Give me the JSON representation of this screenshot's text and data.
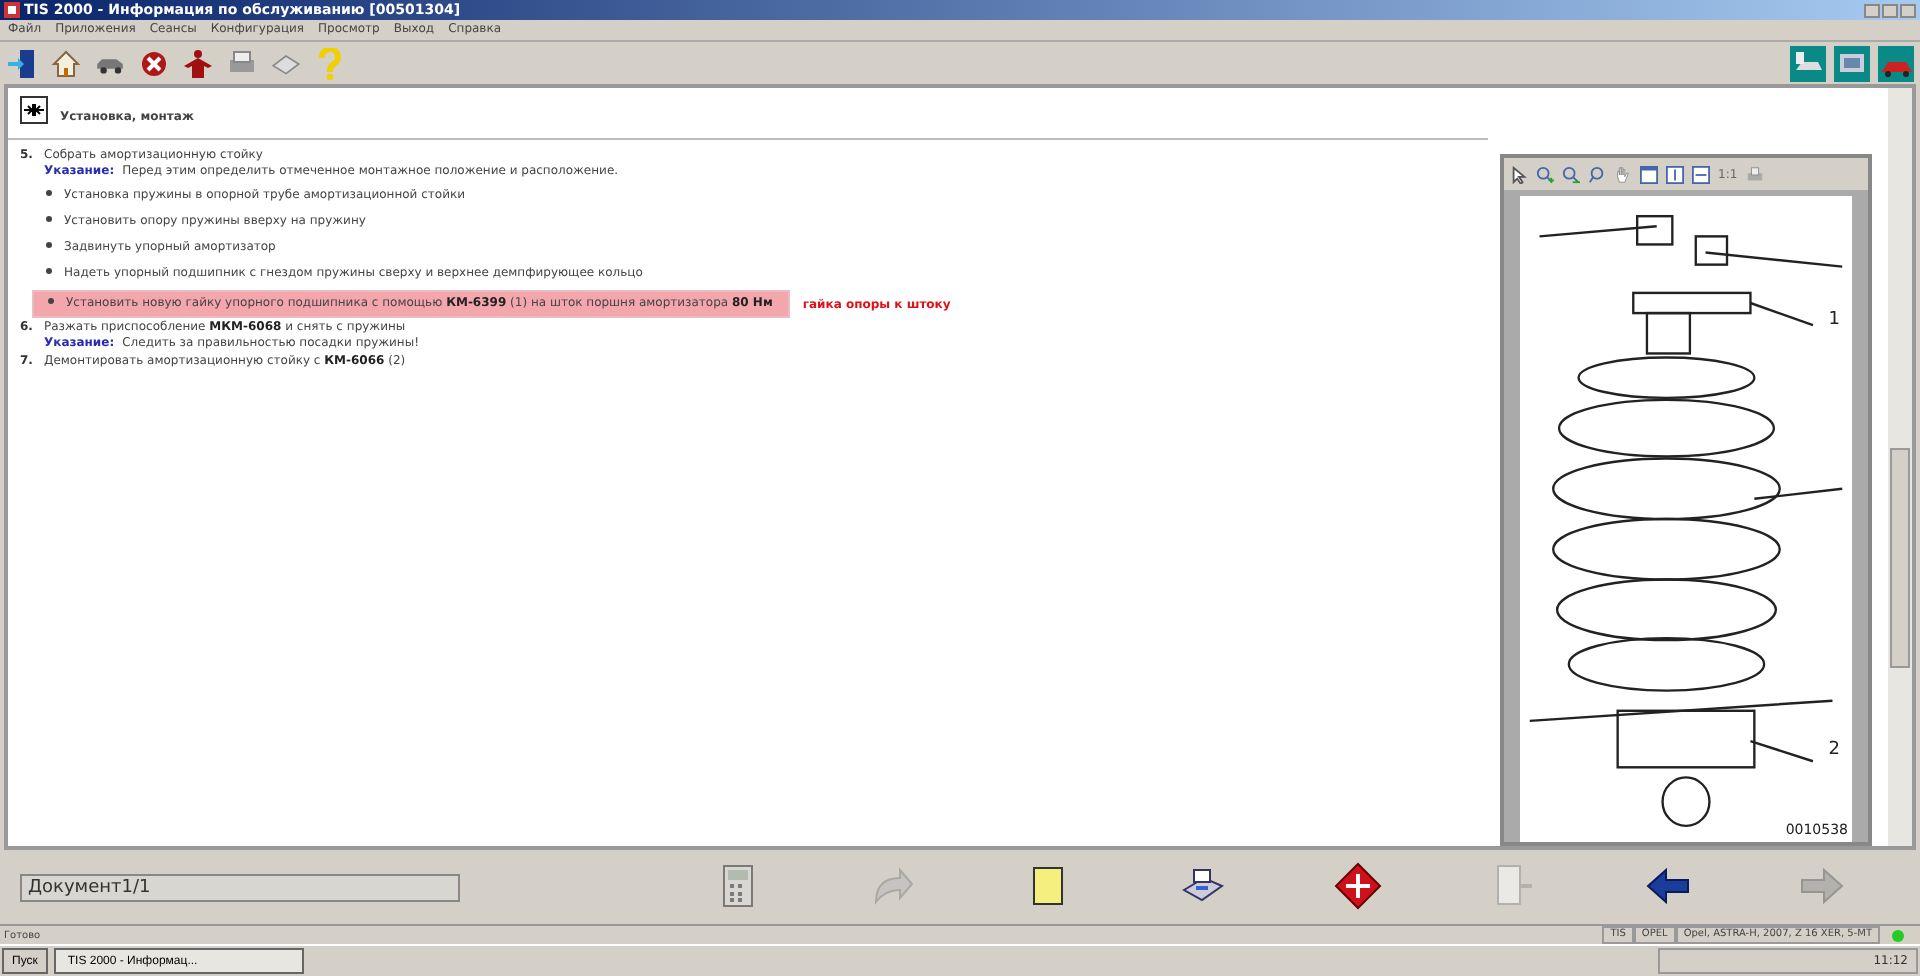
{
  "window": {
    "title": "TIS 2000 - Информация по обслуживанию [00501304]"
  },
  "menu": [
    "Файл",
    "Приложения",
    "Сеансы",
    "Конфигурация",
    "Просмотр",
    "Выход",
    "Справка"
  ],
  "section": {
    "title": "Установка, монтаж"
  },
  "steps": [
    {
      "number": "5.",
      "text": "Собрать амортизационную стойку",
      "note": {
        "label": "Указание:",
        "text": "Перед этим определить отмеченное монтажное положение и расположение."
      },
      "bullets": [
        {
          "text": "Установка пружины в опорной трубе амортизационной стойки",
          "highlighted": false
        },
        {
          "text": "Установить опору пружины вверху на пружину",
          "highlighted": false
        },
        {
          "text": "Задвинуть упорный амортизатор",
          "highlighted": false
        },
        {
          "text": "Надеть упорный подшипник с гнездом пружины сверху и верхнее демпфирующее кольцо",
          "highlighted": false
        },
        {
          "text": "Установить новую гайку упорного подшипника с помощью **КМ-6399** (1) на шток поршня амортизатора **80 Нм**",
          "highlighted": true,
          "annotation": "гайка опоры к штоку"
        }
      ]
    },
    {
      "number": "6.",
      "text": "Разжать приспособление **МКМ-6068** и снять с пружины",
      "note": {
        "label": "Указание:",
        "text": "Следить за правильностью посадки пружины!"
      }
    },
    {
      "number": "7.",
      "text": "Демонтировать амортизационную стойку с **КМ-6066** (2)"
    }
  ],
  "viewer": {
    "scale_label": "1:1",
    "callouts": [
      "1",
      "2"
    ],
    "figure_id": "0010538"
  },
  "document_field": {
    "value": "Документ1/1"
  },
  "nav_buttons": [
    {
      "kind": "calculator",
      "disabled": true
    },
    {
      "kind": "redo",
      "disabled": true
    },
    {
      "kind": "note",
      "disabled": false
    },
    {
      "kind": "printer",
      "disabled": false
    },
    {
      "kind": "warning",
      "disabled": false
    },
    {
      "kind": "page",
      "disabled": true
    },
    {
      "kind": "back",
      "disabled": false
    },
    {
      "kind": "forward",
      "disabled": true
    }
  ],
  "status_bar": {
    "text": "Готово",
    "panes": [
      "TIS",
      "OPEL",
      "Opel, ASTRA-H, 2007, Z 16 XER, 5-MT"
    ]
  },
  "taskbar": {
    "start": "Пуск",
    "task": "TIS 2000 - Информац...",
    "clock": "11:12"
  }
}
